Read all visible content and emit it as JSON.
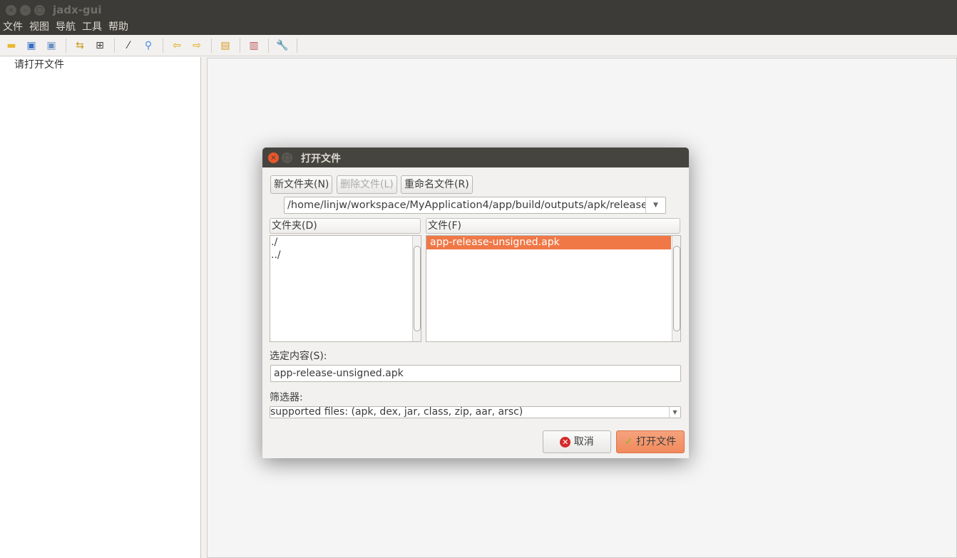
{
  "window": {
    "title": "jadx-gui"
  },
  "menu": [
    "文件",
    "视图",
    "导航",
    "工具",
    "帮助"
  ],
  "toolbar": [
    {
      "icon": "open-folder-icon",
      "glyph": "▬",
      "color": "#e8b832"
    },
    {
      "icon": "save-all-icon",
      "glyph": "▣",
      "color": "#3a6fc4"
    },
    {
      "icon": "export-icon",
      "glyph": "▣",
      "color": "#6b8fc4"
    },
    {
      "icon": "sync-icon",
      "glyph": "⇆",
      "color": "#c99a1a"
    },
    {
      "icon": "flatten-packages-icon",
      "glyph": "⊞",
      "color": "#444"
    },
    {
      "icon": "magic-wand-icon",
      "glyph": "⁄",
      "color": "#333"
    },
    {
      "icon": "search-icon",
      "glyph": "⚲",
      "color": "#4a90d9"
    },
    {
      "icon": "back-arrow-icon",
      "glyph": "⇦",
      "color": "#e0a800"
    },
    {
      "icon": "forward-arrow-icon",
      "glyph": "⇨",
      "color": "#e0a800"
    },
    {
      "icon": "deobfuscation-icon",
      "glyph": "▤",
      "color": "#d99a1a"
    },
    {
      "icon": "log-icon",
      "glyph": "▥",
      "color": "#b55"
    },
    {
      "icon": "preferences-wrench-icon",
      "glyph": "🔧",
      "color": "#4a7fd0"
    }
  ],
  "tree": {
    "placeholder": "请打开文件"
  },
  "dialog": {
    "title": "打开文件",
    "new_folder": "新文件夹(N)",
    "delete_file": "删除文件(L)",
    "rename_file": "重命名文件(R)",
    "path": "/home/linjw/workspace/MyApplication4/app/build/outputs/apk/release",
    "folders_header": "文件夹(D)",
    "files_header": "文件(F)",
    "folders": [
      "./",
      "../"
    ],
    "files": [
      "app-release-unsigned.apk"
    ],
    "selection_label": "选定内容(S):",
    "selection_value": "app-release-unsigned.apk",
    "filter_label": "筛选器:",
    "filter_value": "supported files: (apk, dex, jar, class, zip, aar, arsc)",
    "cancel": "取消",
    "open": "打开文件",
    "accent": "#f07746"
  }
}
